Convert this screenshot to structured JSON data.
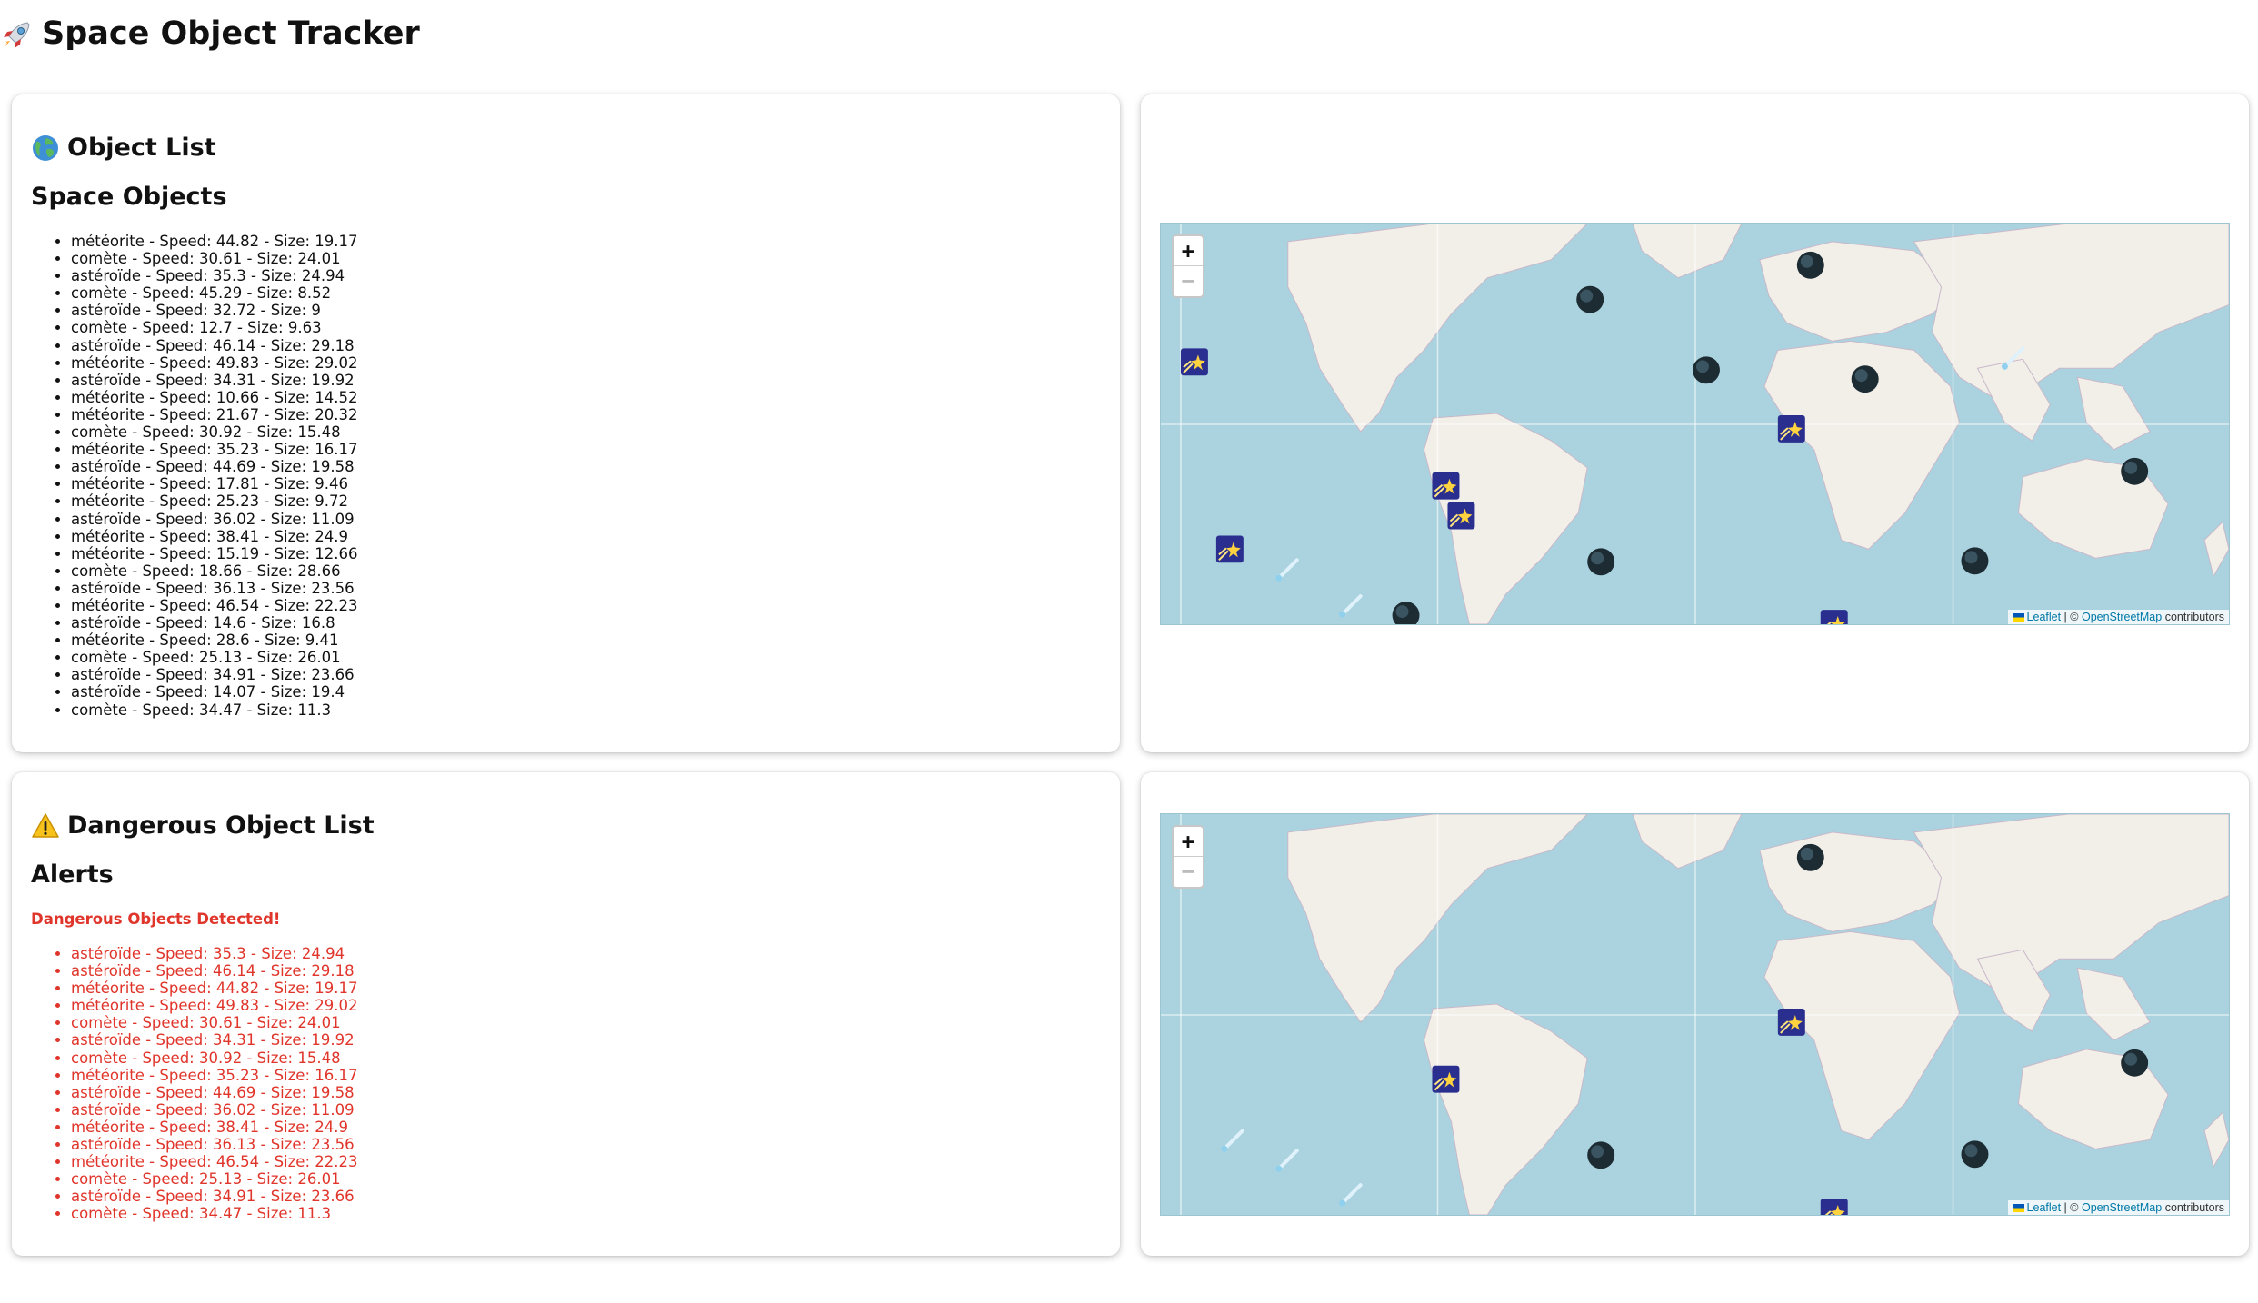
{
  "app": {
    "title": "Space Object Tracker",
    "title_icon": "rocket-icon"
  },
  "object_panel": {
    "heading": "Object List",
    "heading_icon": "globe-icon",
    "subheading": "Space Objects",
    "items": [
      "météorite - Speed: 44.82 - Size: 19.17",
      "comète - Speed: 30.61 - Size: 24.01",
      "astéroïde - Speed: 35.3 - Size: 24.94",
      "comète - Speed: 45.29 - Size: 8.52",
      "astéroïde - Speed: 32.72 - Size: 9",
      "comète - Speed: 12.7 - Size: 9.63",
      "astéroïde - Speed: 46.14 - Size: 29.18",
      "météorite - Speed: 49.83 - Size: 29.02",
      "astéroïde - Speed: 34.31 - Size: 19.92",
      "météorite - Speed: 10.66 - Size: 14.52",
      "météorite - Speed: 21.67 - Size: 20.32",
      "comète - Speed: 30.92 - Size: 15.48",
      "météorite - Speed: 35.23 - Size: 16.17",
      "astéroïde - Speed: 44.69 - Size: 19.58",
      "météorite - Speed: 17.81 - Size: 9.46",
      "météorite - Speed: 25.23 - Size: 9.72",
      "astéroïde - Speed: 36.02 - Size: 11.09",
      "météorite - Speed: 38.41 - Size: 24.9",
      "météorite - Speed: 15.19 - Size: 12.66",
      "comète - Speed: 18.66 - Size: 28.66",
      "astéroïde - Speed: 36.13 - Size: 23.56",
      "météorite - Speed: 46.54 - Size: 22.23",
      "astéroïde - Speed: 14.6 - Size: 16.8",
      "météorite - Speed: 28.6 - Size: 9.41",
      "comète - Speed: 25.13 - Size: 26.01",
      "astéroïde - Speed: 34.91 - Size: 23.66",
      "astéroïde - Speed: 14.07 - Size: 19.4",
      "comète - Speed: 34.47 - Size: 11.3"
    ]
  },
  "danger_panel": {
    "heading": "Dangerous Object List",
    "heading_icon": "warning-icon",
    "subheading": "Alerts",
    "alert_title": "Dangerous Objects Detected!",
    "alert_color": "#e0352b",
    "items": [
      "astéroïde - Speed: 35.3 - Size: 24.94",
      "astéroïde - Speed: 46.14 - Size: 29.18",
      "météorite - Speed: 44.82 - Size: 19.17",
      "météorite - Speed: 49.83 - Size: 29.02",
      "comète - Speed: 30.61 - Size: 24.01",
      "astéroïde - Speed: 34.31 - Size: 19.92",
      "comète - Speed: 30.92 - Size: 15.48",
      "météorite - Speed: 35.23 - Size: 16.17",
      "astéroïde - Speed: 44.69 - Size: 19.58",
      "astéroïde - Speed: 36.02 - Size: 11.09",
      "météorite - Speed: 38.41 - Size: 24.9",
      "astéroïde - Speed: 36.13 - Size: 23.56",
      "météorite - Speed: 46.54 - Size: 22.23",
      "comète - Speed: 25.13 - Size: 26.01",
      "astéroïde - Speed: 34.91 - Size: 23.66",
      "comète - Speed: 34.47 - Size: 11.3"
    ]
  },
  "map": {
    "zoom_in": "+",
    "zoom_out": "−",
    "attribution_leaflet": "Leaflet",
    "attribution_sep": " | © ",
    "attribution_osm": "OpenStreetMap",
    "attribution_tail": " contributors",
    "water_color": "#aad3df",
    "land_color": "#f2efe9",
    "marker_icons": [
      "asteroid-marker-icon",
      "shooting-star-marker-icon",
      "comet-marker-icon"
    ]
  }
}
